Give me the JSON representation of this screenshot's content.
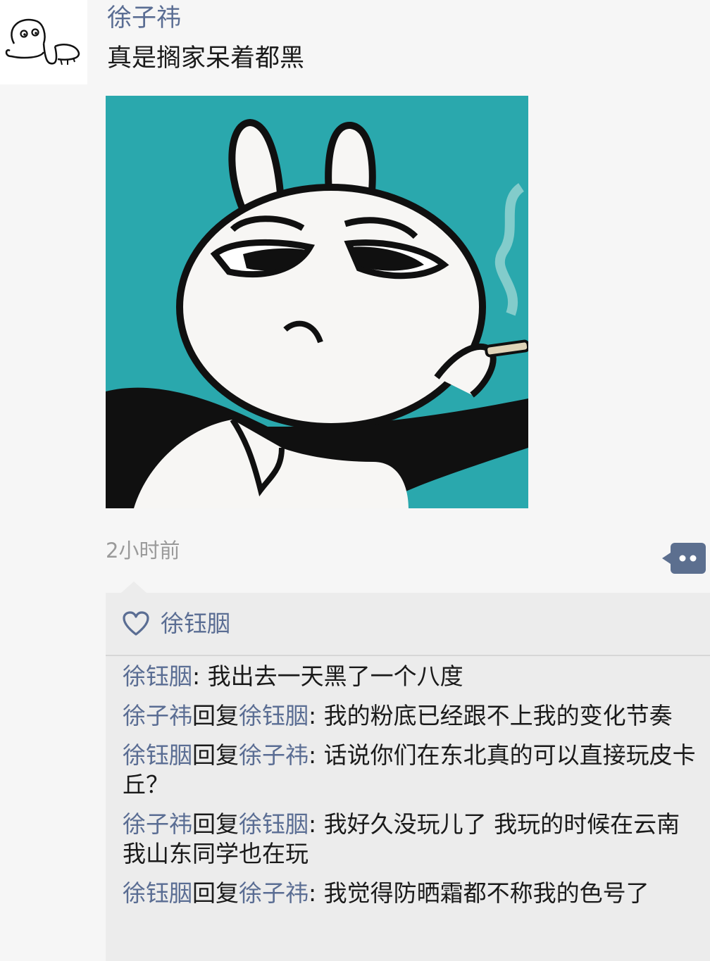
{
  "post": {
    "author": "徐子祎",
    "text": "真是搁家呆着都黑",
    "time": "2小时前"
  },
  "likes": {
    "names": "徐钰胭"
  },
  "comments": [
    {
      "name": "徐钰胭",
      "sep": ": ",
      "text": "我出去一天黑了一个八度"
    },
    {
      "name": "徐子祎",
      "reply_word": "回复",
      "reply_to": "徐钰胭",
      "sep": ": ",
      "text": "我的粉底已经跟不上我的变化节奏"
    },
    {
      "name": "徐钰胭",
      "reply_word": "回复",
      "reply_to": "徐子祎",
      "sep": ": ",
      "text": "话说你们在东北真的可以直接玩皮卡丘？"
    },
    {
      "name": "徐子祎",
      "reply_word": "回复",
      "reply_to": "徐钰胭",
      "sep": ": ",
      "text": "我好久没玩儿了 我玩的时候在云南 我山东同学也在玩"
    },
    {
      "name": "徐钰胭",
      "reply_word": "回复",
      "reply_to": "徐子祎",
      "sep": ": ",
      "text": "我觉得防晒霜都不称我的色号了"
    }
  ],
  "icons": {
    "avatar": "doodle-dog-avatar",
    "like": "heart-icon",
    "action": "comment-dots-icon"
  },
  "colors": {
    "name_link": "#5a6d93",
    "image_bg": "#2aa8ad",
    "action_button": "#5c6f8f"
  }
}
